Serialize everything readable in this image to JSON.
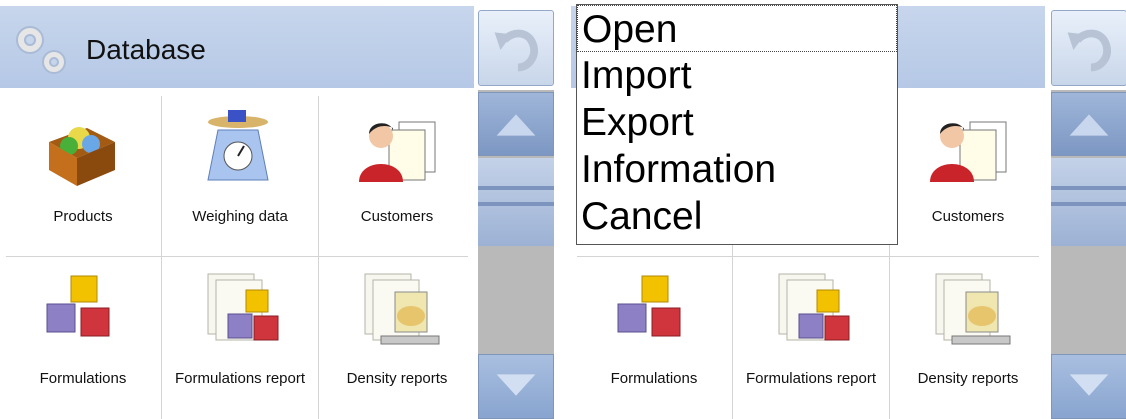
{
  "left": {
    "header": {
      "title": "Database"
    },
    "tiles": [
      {
        "label": "Products"
      },
      {
        "label": "Weighing data"
      },
      {
        "label": "Customers"
      },
      {
        "label": "Formulations"
      },
      {
        "label": "Formulations report"
      },
      {
        "label": "Density reports"
      }
    ]
  },
  "right": {
    "tiles": [
      {
        "label": "Customers"
      },
      {
        "label": "Formulations"
      },
      {
        "label": "Formulations report"
      },
      {
        "label": "Density reports"
      }
    ],
    "menu": [
      "Open",
      "Import",
      "Export",
      "Information",
      "Cancel"
    ]
  },
  "icons": {
    "header": "gears-icon",
    "back": "undo-arrow-icon",
    "up": "arrow-up-icon",
    "down": "arrow-down-icon"
  },
  "colors": {
    "header": "#b5c8e6",
    "scroll_track": "#b9b9b9",
    "button": "#8aa6d1"
  }
}
